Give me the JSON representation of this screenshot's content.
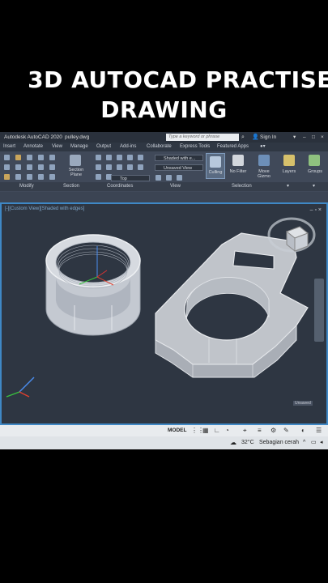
{
  "overlay": {
    "title_line1": "3D AUTOCAD PRACTISE",
    "title_line2": "DRAWING"
  },
  "titlebar": {
    "app_name": "Autodesk AutoCAD 2020",
    "file_name": "pulley.dwg",
    "search_placeholder": "Type a keyword or phrase",
    "sign_in": "Sign In"
  },
  "menubar": {
    "items": [
      "Insert",
      "Annotate",
      "View",
      "Manage",
      "Output",
      "Add-ins",
      "Collaborate",
      "Express Tools",
      "Featured Apps"
    ]
  },
  "ribbon": {
    "section_plane": "Section\nPlane",
    "visual_style": "Shaded with e...",
    "saved_view": "Unsaved View",
    "view_top": "Top",
    "culling": "Culling",
    "no_filter": "No Filter",
    "move_gizmo": "Move\nGizmo",
    "layers": "Layers",
    "groups": "Groups",
    "panels": [
      "Modify",
      "Section",
      "Coordinates",
      "View",
      "Selection"
    ]
  },
  "viewport": {
    "label": "[-][Custom View][Shaded with edges]",
    "viewcube_label": "Unsaved"
  },
  "statusbar": {
    "model": "MODEL"
  },
  "taskbar": {
    "temperature": "32°C",
    "weather": "Sebagian cerah"
  },
  "colors": {
    "viewport_bg": "#2e3642",
    "ribbon_bg": "#404959",
    "accent": "#3f88c5",
    "solid_face": "#b8bcc2"
  }
}
